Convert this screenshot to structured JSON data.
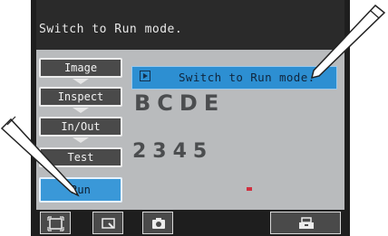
{
  "screen": {
    "message": "Switch to Run mode."
  },
  "menu": {
    "items": [
      {
        "label": "Image"
      },
      {
        "label": "Inspect"
      },
      {
        "label": "In/Out"
      },
      {
        "label": "Test"
      },
      {
        "label": "Run"
      }
    ],
    "active": "Run"
  },
  "popup": {
    "label": "Switch to Run mode."
  },
  "camera_image": {
    "line1": "BCDE",
    "line2": "2345"
  },
  "toolbar": {
    "icons": [
      "frame-icon",
      "zoom-icon",
      "camera-icon",
      "save-icon"
    ]
  },
  "colors": {
    "accent": "#3a98d8",
    "message_bar": "#2a2a2a",
    "screen_bg": "#b9bbbd"
  }
}
